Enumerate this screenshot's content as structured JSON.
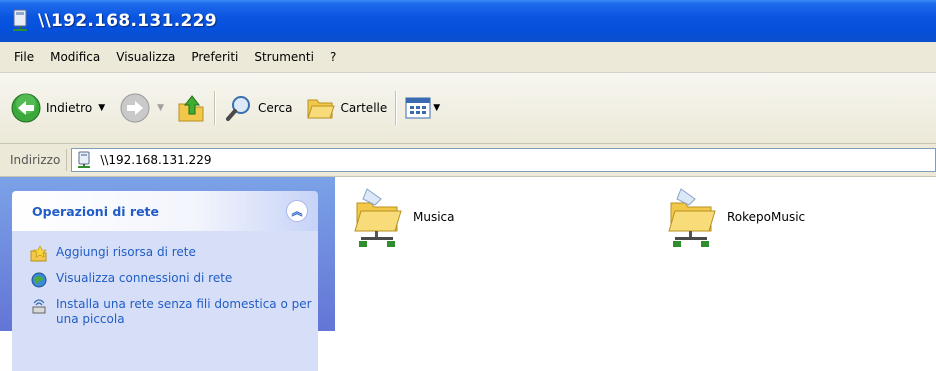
{
  "window": {
    "title": "\\\\192.168.131.229"
  },
  "menu": [
    "File",
    "Modifica",
    "Visualizza",
    "Preferiti",
    "Strumenti",
    "?"
  ],
  "toolbar": {
    "back_label": "Indietro",
    "search_label": "Cerca",
    "folders_label": "Cartelle"
  },
  "address": {
    "label": "Indirizzo",
    "value": "\\\\192.168.131.229"
  },
  "tasks": {
    "title": "Operazioni di rete",
    "items": [
      {
        "label": "Aggiungi risorsa di rete",
        "icon": "add-network-place-icon"
      },
      {
        "label": "Visualizza connessioni di rete",
        "icon": "network-connections-icon"
      },
      {
        "label": "Installa una rete senza fili domestica o per una piccola",
        "icon": "wireless-network-icon"
      }
    ]
  },
  "shares": [
    {
      "name": "Musica",
      "icon": "shared-folder-icon"
    },
    {
      "name": "RokepoMusic",
      "icon": "shared-folder-icon"
    }
  ],
  "colors": {
    "titlebar": "#0550dc",
    "task_link": "#215dc6",
    "left_pane": "#6f8ee0"
  }
}
